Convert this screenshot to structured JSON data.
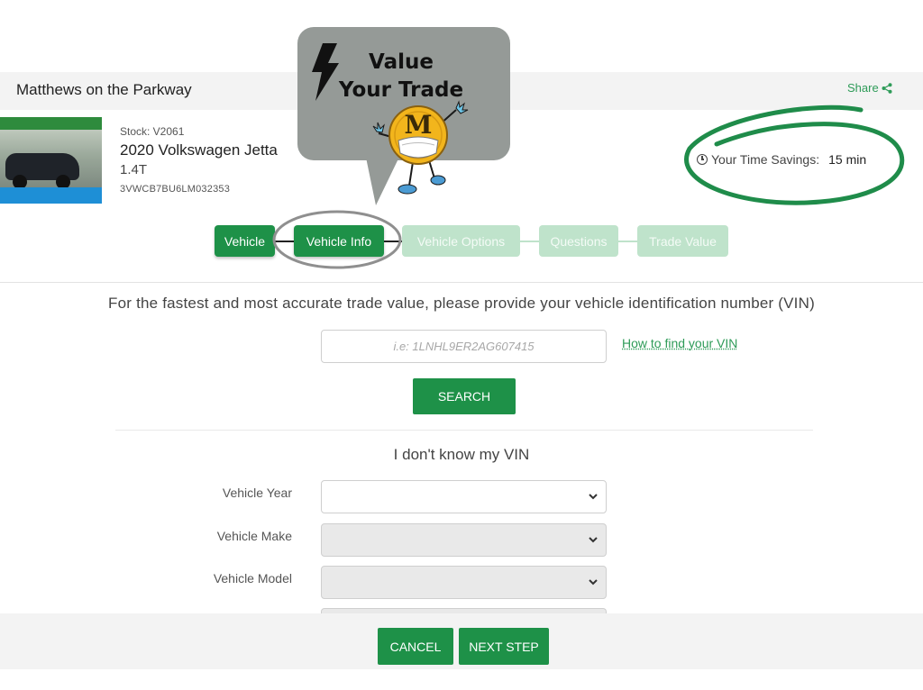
{
  "header": {
    "dealer_name": "Matthews on the Parkway",
    "share_label": "Share"
  },
  "vehicle": {
    "stock": "Stock: V2061",
    "name": "2020 Volkswagen Jetta",
    "trim": "1.4T",
    "vin": "3VWCB7BU6LM032353"
  },
  "time_savings": {
    "label": "Your Time Savings:",
    "value": "15 min"
  },
  "steps": [
    {
      "label": "Vehicle",
      "state": "completed"
    },
    {
      "label": "Vehicle Info",
      "state": "current"
    },
    {
      "label": "Vehicle Options",
      "state": "upcoming"
    },
    {
      "label": "Questions",
      "state": "upcoming"
    },
    {
      "label": "Trade Value",
      "state": "upcoming"
    }
  ],
  "callout": {
    "line1": "Value",
    "line2": "Your Trade",
    "mascot_letter": "M"
  },
  "vin_section": {
    "intro": "For the fastest and most accurate trade value, please provide your vehicle identification number (VIN)",
    "placeholder": "i.e: 1LNHL9ER2AG607415",
    "help_link": "How to find your VIN",
    "search_label": "SEARCH"
  },
  "manual_section": {
    "heading": "I don't know my VIN",
    "fields": [
      {
        "label": "Vehicle Year",
        "value": "",
        "disabled": false
      },
      {
        "label": "Vehicle Make",
        "value": "",
        "disabled": true
      },
      {
        "label": "Vehicle Model",
        "value": "",
        "disabled": true
      }
    ]
  },
  "footer": {
    "cancel_label": "CANCEL",
    "next_label": "NEXT STEP"
  },
  "colors": {
    "primary_green": "#1e9148",
    "inactive_green": "#bfe3cb",
    "link_green": "#2e9b58",
    "callout_gray": "#959a97",
    "mascot_gold": "#f2b51c"
  }
}
